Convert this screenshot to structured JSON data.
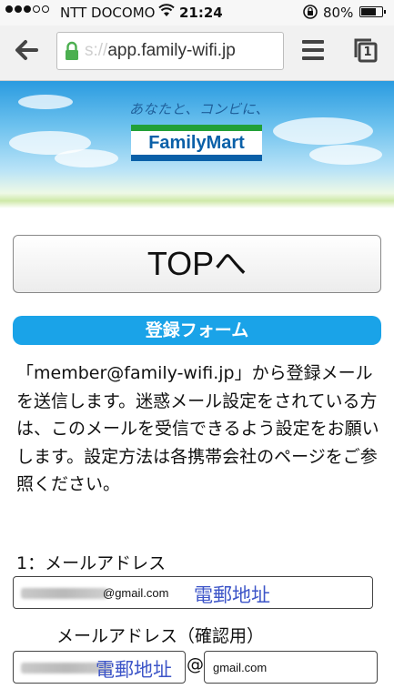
{
  "status_bar": {
    "carrier": "NTT DOCOMO",
    "time": "21:24",
    "battery": "80%",
    "battery_level": 0.8
  },
  "browser": {
    "url_prefix": "s://",
    "url_main": "app.family-wifi.jp",
    "tab_count": "1",
    "icons": [
      "back-arrow-icon",
      "lock-icon",
      "menu-icon",
      "tabs-icon"
    ]
  },
  "banner": {
    "tagline": "あなたと、コンビに、",
    "logo_text": "FamilyMart"
  },
  "top_button": {
    "label": "TOPへ"
  },
  "form": {
    "section_title": "登録フォーム",
    "notice": "「member@family-wifi.jp」から登録メールを送信します。迷惑メール設定をされている方は、このメールを受信できるよう設定をお願いします。設定方法は各携帯会社のページをご参照ください。",
    "email_label": "1：メールアドレス",
    "email_value_domain": "@gmail.com",
    "email_annotation": "電郵地址",
    "confirm_label": "メールアドレス（確認用）",
    "confirm_annotation": "電郵地址",
    "at_symbol": "@",
    "confirm_domain_value": "gmail.com"
  },
  "colors": {
    "section_blue": "#1aa3e8",
    "fm_green": "#22a038",
    "fm_blue": "#0a60a8",
    "annotation_blue": "#3d55c8"
  }
}
